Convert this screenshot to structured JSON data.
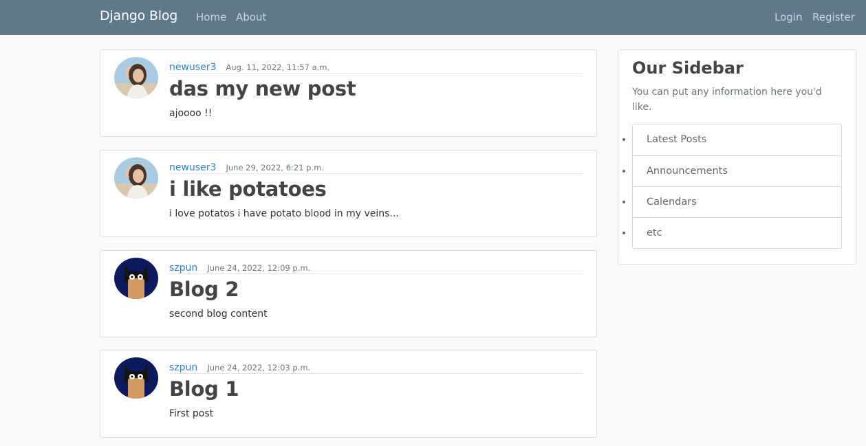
{
  "navbar": {
    "brand": "Django Blog",
    "links": [
      "Home",
      "About"
    ],
    "right_links": [
      "Login",
      "Register"
    ]
  },
  "posts": [
    {
      "author": "newuser3",
      "date": "Aug. 11, 2022, 11:57 a.m.",
      "title": "das my new post",
      "content": "ajoooo !!",
      "avatar_icon": "woman-photo-avatar"
    },
    {
      "author": "newuser3",
      "date": "June 29, 2022, 6:21 p.m.",
      "title": "i like potatoes",
      "content": "i love potatos i have potato blood in my veins...",
      "avatar_icon": "woman-photo-avatar"
    },
    {
      "author": "szpun",
      "date": "June 24, 2022, 12:09 p.m.",
      "title": "Blog 2",
      "content": "second blog content",
      "avatar_icon": "bat-mask-cartoon-avatar"
    },
    {
      "author": "szpun",
      "date": "June 24, 2022, 12:03 p.m.",
      "title": "Blog 1",
      "content": "First post",
      "avatar_icon": "bat-mask-cartoon-avatar"
    }
  ],
  "sidebar": {
    "title": "Our Sidebar",
    "text": "You can put any information here you'd like.",
    "items": [
      "Latest Posts",
      "Announcements",
      "Calendars",
      "etc"
    ]
  },
  "colors": {
    "navbar_bg": "#5f788a",
    "link": "#2a7fd4",
    "page_bg": "#fafafa"
  }
}
